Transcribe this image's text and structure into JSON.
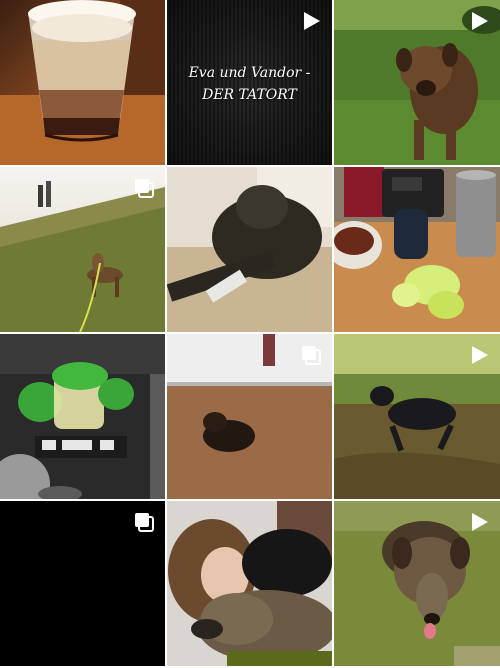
{
  "grid": {
    "columns": 3,
    "tiles": [
      {
        "subject": "latte-macchiato-glass",
        "overlay": "none"
      },
      {
        "subject": "title-card",
        "overlay": "video-icon",
        "caption_line1": "Eva und Vandor -",
        "caption_line2": "DER TATORT"
      },
      {
        "subject": "dog-on-grass",
        "overlay": "video-icon"
      },
      {
        "subject": "people-walking-dog-on-dyke",
        "overlay": "carousel-icon"
      },
      {
        "subject": "dog-lying-bandaged-paw",
        "overlay": "none"
      },
      {
        "subject": "kitchen-counter-dog-toys",
        "overlay": "none"
      },
      {
        "subject": "car-cupholder-containers",
        "overlay": "none"
      },
      {
        "subject": "dog-lying-on-floor",
        "overlay": "carousel-icon"
      },
      {
        "subject": "dog-running-on-dirt",
        "overlay": "video-icon"
      },
      {
        "subject": "black-image",
        "overlay": "carousel-icon"
      },
      {
        "subject": "woman-cuddling-dog",
        "overlay": "none"
      },
      {
        "subject": "dog-on-lawn-tongue-out",
        "overlay": "video-icon"
      }
    ]
  }
}
